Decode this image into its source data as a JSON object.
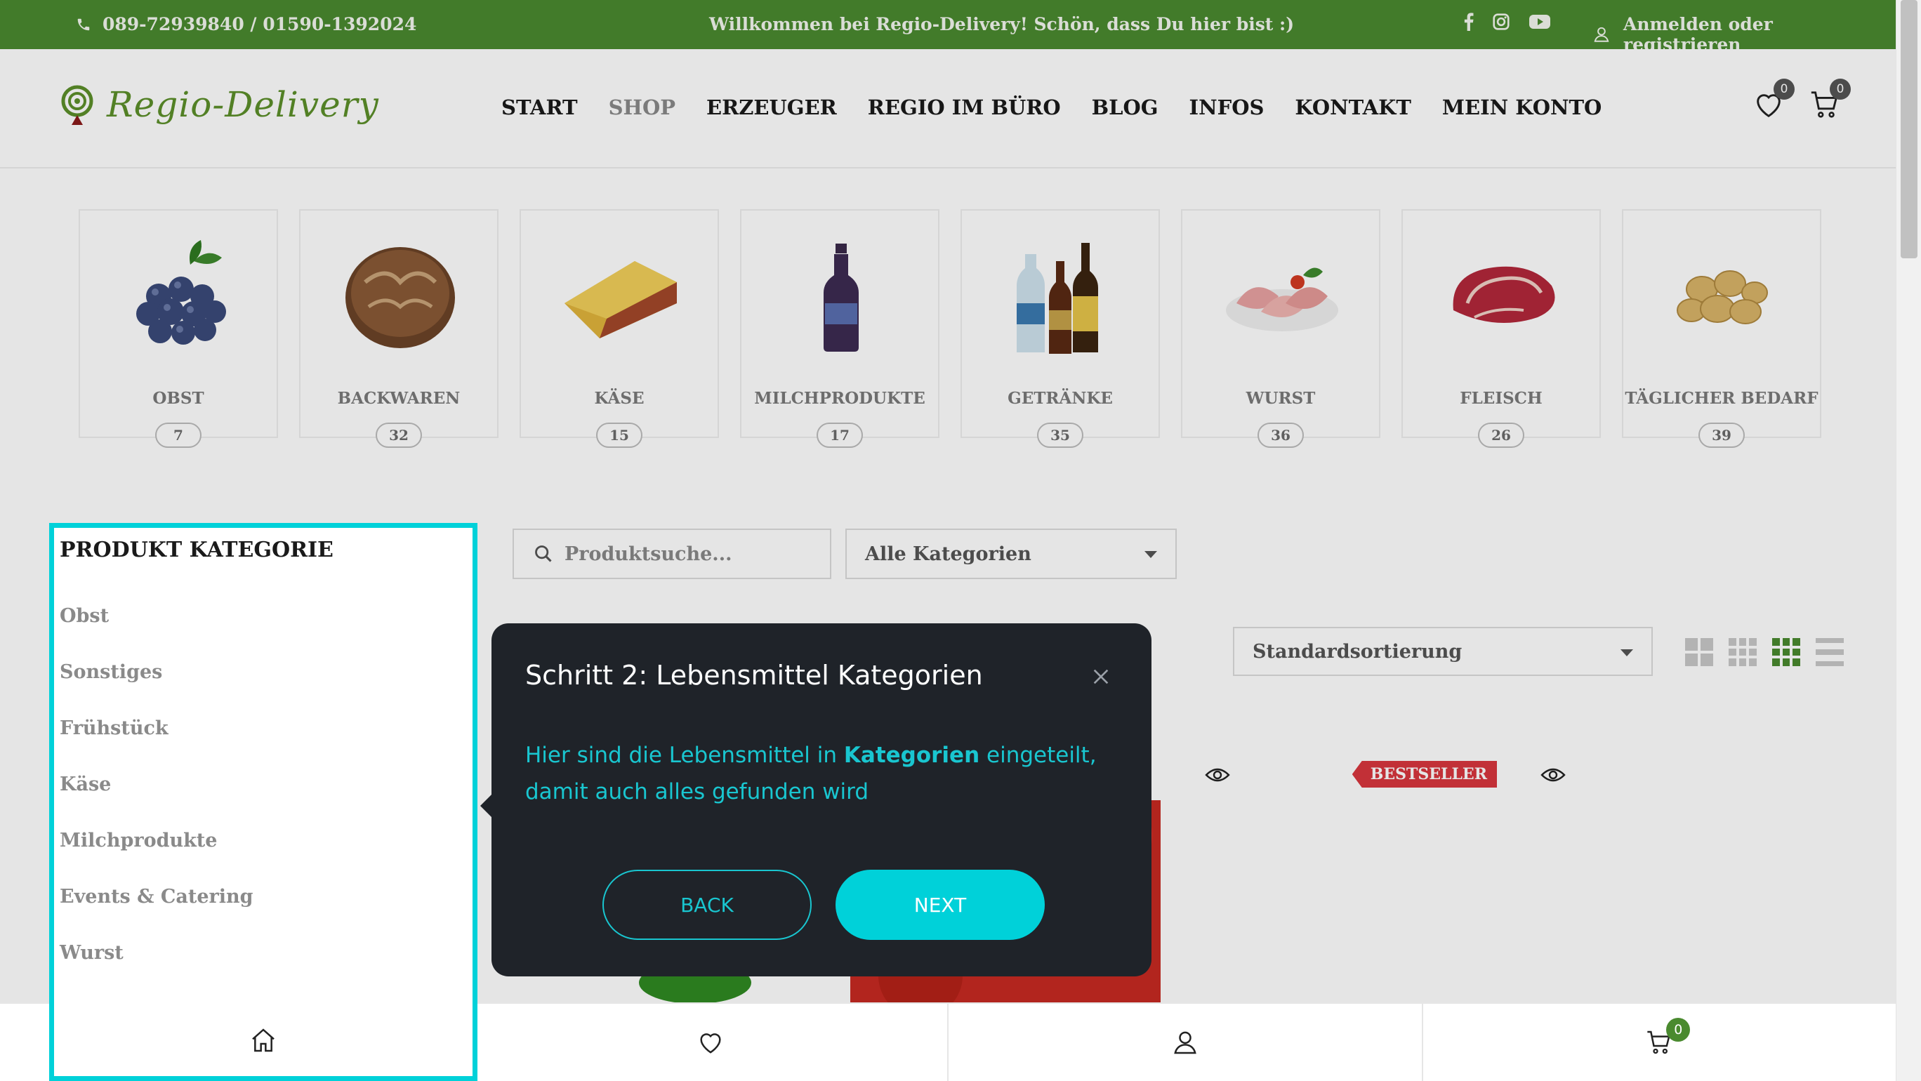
{
  "topbar": {
    "phone": "089-72939840 / 01590-1392024",
    "welcome": "Willkommen bei Regio-Delivery! Schön, dass Du hier bist :)",
    "social_icons": [
      "facebook-icon",
      "instagram-icon",
      "youtube-icon"
    ],
    "login": "Anmelden oder registrieren"
  },
  "header": {
    "logo": "Regio-Delivery",
    "nav": [
      "START",
      "SHOP",
      "ERZEUGER",
      "REGIO IM BÜRO",
      "BLOG",
      "INFOS",
      "KONTAKT",
      "MEIN KONTO"
    ],
    "active_nav": "SHOP",
    "wishlist_count": "0",
    "cart_count": "0"
  },
  "categories": [
    {
      "name": "OBST",
      "count": "7"
    },
    {
      "name": "BACKWAREN",
      "count": "32"
    },
    {
      "name": "KÄSE",
      "count": "15"
    },
    {
      "name": "MILCHPRODUKTE",
      "count": "17"
    },
    {
      "name": "GETRÄNKE",
      "count": "35"
    },
    {
      "name": "WURST",
      "count": "36"
    },
    {
      "name": "FLEISCH",
      "count": "26"
    },
    {
      "name": "TÄGLICHER BEDARF",
      "count": "39"
    }
  ],
  "sidebar": {
    "title": "PRODUKT KATEGORIE",
    "items": [
      "Obst",
      "Sonstiges",
      "Frühstück",
      "Käse",
      "Milchprodukte",
      "Events & Catering",
      "Wurst"
    ]
  },
  "search": {
    "placeholder": "Produktsuche...",
    "category_select": "Alle Kategorien",
    "sort_select": "Standardsortierung"
  },
  "products": {
    "badge": "BESTSELLER"
  },
  "tour": {
    "title": "Schritt 2: Lebensmittel Kategorien",
    "text_before": "Hier sind die Lebensmittel in ",
    "text_bold": "Kategorien",
    "text_after": " eingeteilt, damit auch alles gefunden wird",
    "back": "BACK",
    "next": "NEXT"
  },
  "bottombar": {
    "cart_count": "0"
  },
  "colors": {
    "brand_green": "#4a8a2f",
    "tour_accent": "#00d1d9",
    "popover_bg": "#1f2329",
    "bestseller_red": "#d9363e"
  }
}
